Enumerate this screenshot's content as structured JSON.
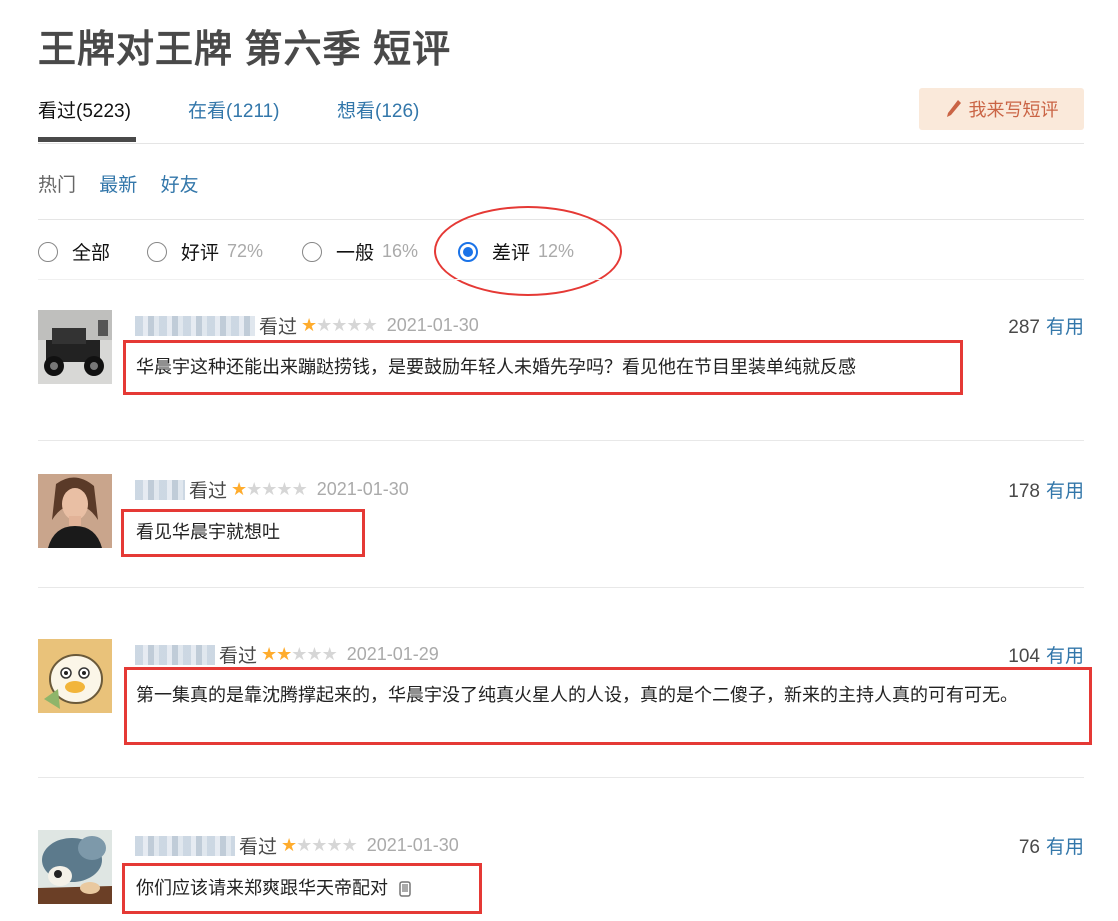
{
  "page": {
    "title": "王牌对王牌 第六季 短评"
  },
  "tabs": [
    {
      "label": "看过(5223)",
      "active": true
    },
    {
      "label": "在看(1211)"
    },
    {
      "label": "想看(126)"
    }
  ],
  "write_button": {
    "label": "我来写短评",
    "icon": "pencil-icon"
  },
  "sorts": [
    {
      "label": "热门",
      "active": true
    },
    {
      "label": "最新"
    },
    {
      "label": "好友"
    }
  ],
  "filters": [
    {
      "label": "全部",
      "pct": "",
      "checked": false
    },
    {
      "label": "好评",
      "pct": "72%",
      "checked": false
    },
    {
      "label": "一般",
      "pct": "16%",
      "checked": false
    },
    {
      "label": "差评",
      "pct": "12%",
      "checked": true
    }
  ],
  "comments": [
    {
      "status": "看过",
      "rating": 1,
      "date": "2021-01-30",
      "votes": "287",
      "useful": "有用",
      "text": "华晨宇这种还能出来蹦跶捞钱，是要鼓励年轻人未婚先孕吗？看见他在节目里装单纯就反感"
    },
    {
      "status": "看过",
      "rating": 1,
      "date": "2021-01-30",
      "votes": "178",
      "useful": "有用",
      "text": "看见华晨宇就想吐"
    },
    {
      "status": "看过",
      "rating": 2,
      "date": "2021-01-29",
      "votes": "104",
      "useful": "有用",
      "text": "第一集真的是靠沈腾撑起来的，华晨宇没了纯真火星人的人设，真的是个二傻子，新来的主持人真的可有可无。"
    },
    {
      "status": "看过",
      "rating": 1,
      "date": "2021-01-30",
      "votes": "76",
      "useful": "有用",
      "text": "你们应该请来郑爽跟华天帝配对"
    }
  ],
  "colors": {
    "link": "#3377aa",
    "star": "#ffac2d",
    "annotation": "#e53935",
    "radio": "#1a73e8"
  }
}
